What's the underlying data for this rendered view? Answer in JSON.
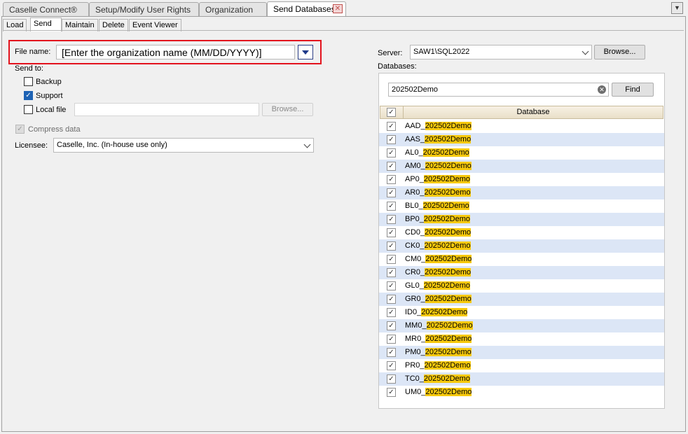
{
  "top_tabs": [
    {
      "label": "Caselle Connect®"
    },
    {
      "label": "Setup/Modify User Rights"
    },
    {
      "label": "Organization"
    },
    {
      "label": "Send Databases"
    }
  ],
  "sub_tabs": [
    {
      "label": "Load"
    },
    {
      "label": "Send"
    },
    {
      "label": "Maintain"
    },
    {
      "label": "Delete"
    },
    {
      "label": "Event Viewer"
    }
  ],
  "form": {
    "file_name_label": "File name:",
    "file_name_value": "[Enter the organization name (MM/DD/YYYY)]",
    "send_to_label": "Send to:",
    "backup_label": "Backup",
    "backup_checked": false,
    "support_label": "Support",
    "support_checked": true,
    "local_file_label": "Local file",
    "local_file_checked": false,
    "local_file_value": "",
    "browse_label": "Browse...",
    "compress_label": "Compress data",
    "compress_checked": true,
    "licensee_label": "Licensee:",
    "licensee_value": "Caselle, Inc. (In-house use only)"
  },
  "server": {
    "label": "Server:",
    "value": "SAW1\\SQL2022",
    "browse_label": "Browse...",
    "databases_label": "Databases:",
    "search_value": "202502Demo",
    "find_label": "Find",
    "column_header": "Database"
  },
  "databases": [
    {
      "prefix": "AAD_",
      "match": "202502Demo",
      "checked": true
    },
    {
      "prefix": "AAS_",
      "match": "202502Demo",
      "checked": true
    },
    {
      "prefix": "AL0_",
      "match": "202502Demo",
      "checked": true
    },
    {
      "prefix": "AM0_",
      "match": "202502Demo",
      "checked": true
    },
    {
      "prefix": "AP0_",
      "match": "202502Demo",
      "checked": true
    },
    {
      "prefix": "AR0_",
      "match": "202502Demo",
      "checked": true
    },
    {
      "prefix": "BL0_",
      "match": "202502Demo",
      "checked": true
    },
    {
      "prefix": "BP0_",
      "match": "202502Demo",
      "checked": true
    },
    {
      "prefix": "CD0_",
      "match": "202502Demo",
      "checked": true
    },
    {
      "prefix": "CK0_",
      "match": "202502Demo",
      "checked": true
    },
    {
      "prefix": "CM0_",
      "match": "202502Demo",
      "checked": true
    },
    {
      "prefix": "CR0_",
      "match": "202502Demo",
      "checked": true
    },
    {
      "prefix": "GL0_",
      "match": "202502Demo",
      "checked": true
    },
    {
      "prefix": "GR0_",
      "match": "202502Demo",
      "checked": true
    },
    {
      "prefix": "ID0_",
      "match": "202502Demo",
      "checked": true
    },
    {
      "prefix": "MM0_",
      "match": "202502Demo",
      "checked": true
    },
    {
      "prefix": "MR0_",
      "match": "202502Demo",
      "checked": true
    },
    {
      "prefix": "PM0_",
      "match": "202502Demo",
      "checked": true
    },
    {
      "prefix": "PR0_",
      "match": "202502Demo",
      "checked": true
    },
    {
      "prefix": "TC0_",
      "match": "202502Demo",
      "checked": true
    },
    {
      "prefix": "UM0_",
      "match": "202502Demo",
      "checked": true
    }
  ],
  "colors": {
    "highlight_border": "#e3121d",
    "search_match": "#f7c90d",
    "alt_row": "#dce6f6",
    "check_blue": "#1d62b4"
  },
  "icons": {
    "close_tab": "close-icon",
    "file_dropdown": "chevron-down-icon",
    "clear_search": "clear-icon"
  }
}
